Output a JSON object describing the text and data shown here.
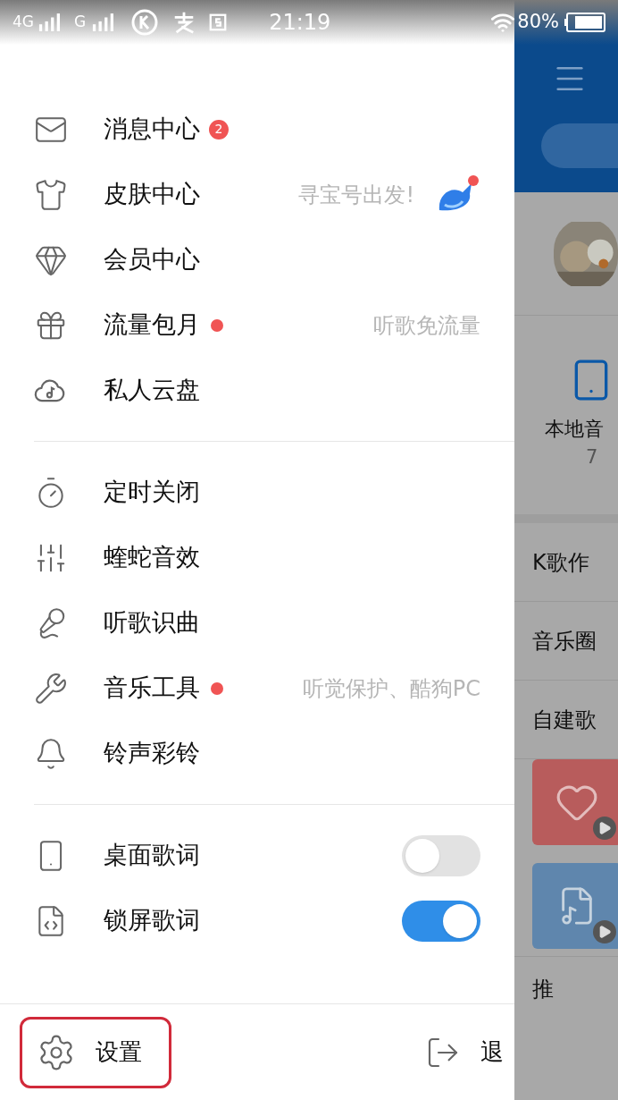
{
  "status_bar": {
    "network_1": "4G",
    "network_2": "G",
    "time": "21:19",
    "battery": "80%"
  },
  "menu_groups": [
    [
      {
        "kind": "link",
        "label": "消息中心",
        "badge": "2",
        "dot": false
      },
      {
        "kind": "link",
        "label": "皮肤中心",
        "hint": "寻宝号出发!",
        "dot": false
      },
      {
        "kind": "link",
        "label": "会员中心",
        "dot": false
      },
      {
        "kind": "link",
        "label": "流量包月",
        "dot": true,
        "hint": "听歌免流量"
      },
      {
        "kind": "link",
        "label": "私人云盘",
        "dot": false
      }
    ],
    [
      {
        "kind": "link",
        "label": "定时关闭",
        "dot": false
      },
      {
        "kind": "link",
        "label": "蝰蛇音效",
        "dot": false
      },
      {
        "kind": "link",
        "label": "听歌识曲",
        "dot": false
      },
      {
        "kind": "link",
        "label": "音乐工具",
        "dot": true,
        "hint": "听觉保护、酷狗PC"
      },
      {
        "kind": "link",
        "label": "铃声彩铃",
        "dot": false
      }
    ],
    [
      {
        "kind": "toggle",
        "label": "桌面歌词",
        "on": false
      },
      {
        "kind": "toggle",
        "label": "锁屏歌词",
        "on": true
      }
    ]
  ],
  "footer": {
    "settings": {
      "label": "设置",
      "highlighted": true
    },
    "exit": {
      "label": "退"
    }
  },
  "background": {
    "local_music": {
      "label": "本地音",
      "count": "7"
    },
    "rows": [
      "K歌作",
      "音乐圈",
      "自建歌"
    ],
    "section": "推"
  }
}
